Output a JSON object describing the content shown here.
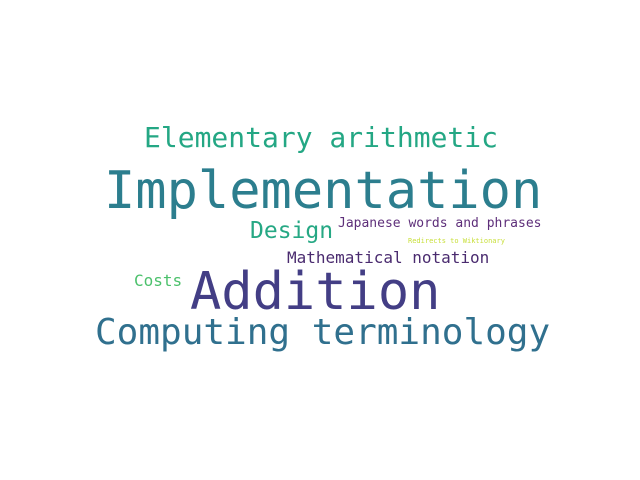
{
  "word_cloud": {
    "words": [
      {
        "id": "implementation",
        "text": "Implementation",
        "color": "#2c7e8e"
      },
      {
        "id": "addition",
        "text": "Addition",
        "color": "#433e85"
      },
      {
        "id": "computing",
        "text": "Computing terminology",
        "color": "#30708e"
      },
      {
        "id": "elementary",
        "text": "Elementary arithmetic",
        "color": "#24a784"
      },
      {
        "id": "design",
        "text": "Design",
        "color": "#26a884"
      },
      {
        "id": "japanese",
        "text": "Japanese words and phrases",
        "color": "#5e2f7a"
      },
      {
        "id": "mathematical",
        "text": "Mathematical notation",
        "color": "#4a2b6f"
      },
      {
        "id": "costs",
        "text": "Costs",
        "color": "#4cc16c"
      },
      {
        "id": "redirects",
        "text": "Redirects to Wiktionary",
        "color": "#c8df3a"
      }
    ]
  }
}
